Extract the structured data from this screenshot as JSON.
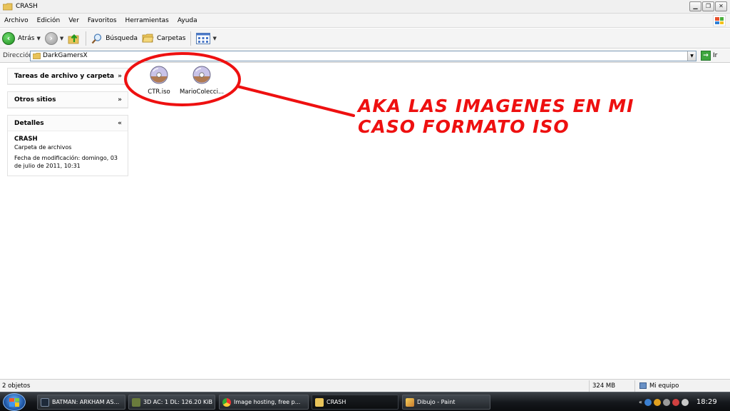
{
  "window": {
    "title": "CRASH"
  },
  "menu": [
    "Archivo",
    "Edición",
    "Ver",
    "Favoritos",
    "Herramientas",
    "Ayuda"
  ],
  "toolbar": {
    "back_label": "Atrás",
    "search_label": "Búsqueda",
    "folders_label": "Carpetas"
  },
  "address": {
    "label": "Dirección",
    "value": "DarkGamersX",
    "go_label": "Ir"
  },
  "tasks": {
    "file_tasks_title": "Tareas de archivo y carpeta",
    "other_places_title": "Otros sitios",
    "details_title": "Detalles",
    "details_name": "CRASH",
    "details_type": "Carpeta de archivos",
    "details_modified": "Fecha de modificación: domingo, 03 de julio de 2011, 10:31"
  },
  "files": [
    {
      "name": "CTR.iso"
    },
    {
      "name": "MarioColecci..."
    }
  ],
  "annotation": {
    "line1": "AKA LAS IMAGENES EN MI",
    "line2": "CASO FORMATO ISO",
    "color": "#ee1010"
  },
  "status": {
    "objects": "2 objetos",
    "size": "324 MB",
    "location": "Mi equipo"
  },
  "taskbar": {
    "items": [
      {
        "label": "BATMAN: ARKHAM AS..."
      },
      {
        "label": "3D AC: 1 DL: 126.20 KiB"
      },
      {
        "label": "Image hosting, free p..."
      },
      {
        "label": "CRASH"
      },
      {
        "label": "Dibujo - Paint"
      }
    ],
    "clock": "18:29"
  }
}
